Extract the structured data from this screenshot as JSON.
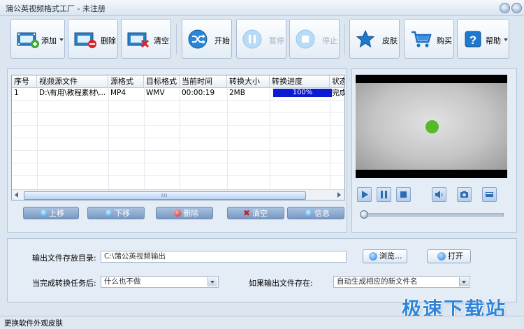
{
  "window": {
    "title": "蒲公英视频格式工厂 - 未注册"
  },
  "toolbar": {
    "add": "添加",
    "delete": "删除",
    "clear": "清空",
    "start": "开始",
    "pause": "暂停",
    "stop": "停止",
    "skin": "皮肤",
    "buy": "购买",
    "help": "帮助"
  },
  "table": {
    "columns": [
      "序号",
      "视频源文件",
      "源格式",
      "目标格式",
      "当前时间",
      "转换大小",
      "转换进度",
      "状态"
    ],
    "rows": [
      {
        "index": "1",
        "source": "D:\\有用\\教程素材\\...",
        "src_format": "MP4",
        "dst_format": "WMV",
        "time": "00:00:19",
        "size": "2MB",
        "progress": "100%",
        "progress_value": 100,
        "status": "完成"
      }
    ]
  },
  "list_buttons": {
    "up": "上移",
    "down": "下移",
    "delete": "删除",
    "clear": "清空",
    "info": "信息"
  },
  "output": {
    "dir_label": "输出文件存放目录:",
    "dir_value": "C:\\蒲公英视频输出",
    "browse": "浏览...",
    "open": "打开",
    "after_label": "当完成转换任务后:",
    "after_value": "什么也不做",
    "exists_label": "如果输出文件存在:",
    "exists_value": "自动生成相应的新文件名"
  },
  "player": {
    "seek_value": 0
  },
  "status": {
    "text": "更换软件外观皮肤"
  },
  "watermark": {
    "text": "极速下载站"
  },
  "colors": {
    "progress": "#0a1bd3",
    "accent": "#2f86d8",
    "video_dot": "#57b82a"
  }
}
